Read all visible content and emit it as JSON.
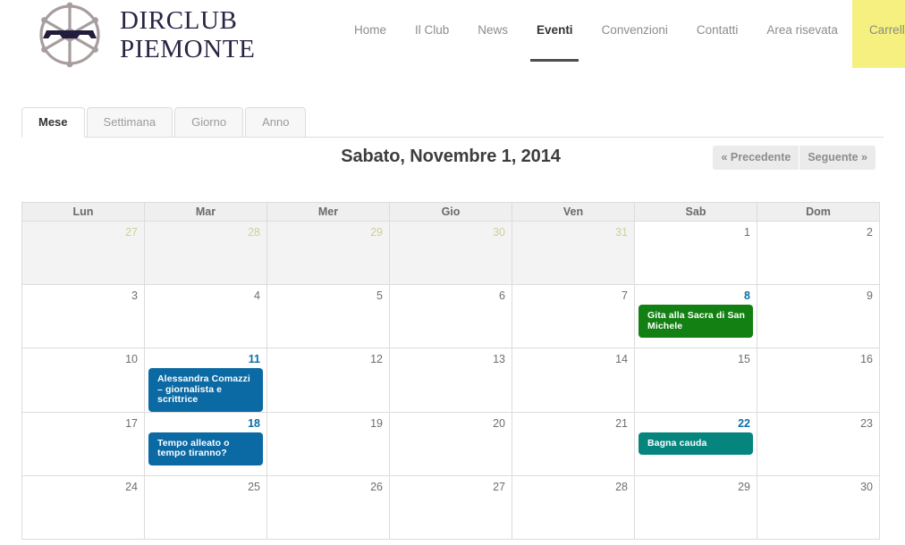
{
  "brand": {
    "logo_icon": "ship-wheel-logo",
    "line1": "DIRCLUB",
    "line2": "PIEMONTE"
  },
  "nav": {
    "items": [
      {
        "label": "Home",
        "active": false,
        "cart": false
      },
      {
        "label": "Il Club",
        "active": false,
        "cart": false
      },
      {
        "label": "News",
        "active": false,
        "cart": false
      },
      {
        "label": "Eventi",
        "active": true,
        "cart": false
      },
      {
        "label": "Convenzioni",
        "active": false,
        "cart": false
      },
      {
        "label": "Contatti",
        "active": false,
        "cart": false
      },
      {
        "label": "Area risevata",
        "active": false,
        "cart": false
      },
      {
        "label": "Carrello",
        "active": false,
        "cart": true
      }
    ],
    "cart_bg": "#f5f07f",
    "active_underline": "#4d4d4d"
  },
  "view_tabs": {
    "items": [
      {
        "label": "Mese",
        "active": true
      },
      {
        "label": "Settimana",
        "active": false
      },
      {
        "label": "Giorno",
        "active": false
      },
      {
        "label": "Anno",
        "active": false
      }
    ]
  },
  "calendar_header": {
    "title": "Sabato, Novembre 1, 2014",
    "prev_label": "« Precedente",
    "next_label": "Seguente »"
  },
  "calendar": {
    "weekdays": [
      "Lun",
      "Mar",
      "Mer",
      "Gio",
      "Ven",
      "Sab",
      "Dom"
    ],
    "today_border_color": "#80801a",
    "event_day_bg": "#fbfbe2",
    "link_color": "#0a6ea8",
    "weeks": [
      [
        {
          "day": "27",
          "other_month": true,
          "today": false,
          "events": []
        },
        {
          "day": "28",
          "other_month": true,
          "today": false,
          "events": []
        },
        {
          "day": "29",
          "other_month": true,
          "today": false,
          "events": []
        },
        {
          "day": "30",
          "other_month": true,
          "today": false,
          "events": []
        },
        {
          "day": "31",
          "other_month": true,
          "today": false,
          "events": []
        },
        {
          "day": "1",
          "other_month": false,
          "today": false,
          "events": []
        },
        {
          "day": "2",
          "other_month": false,
          "today": false,
          "events": []
        }
      ],
      [
        {
          "day": "3",
          "other_month": false,
          "today": false,
          "events": []
        },
        {
          "day": "4",
          "other_month": false,
          "today": false,
          "events": []
        },
        {
          "day": "5",
          "other_month": false,
          "today": false,
          "events": []
        },
        {
          "day": "6",
          "other_month": false,
          "today": false,
          "events": []
        },
        {
          "day": "7",
          "other_month": false,
          "today": false,
          "events": []
        },
        {
          "day": "8",
          "other_month": false,
          "today": false,
          "events": [
            {
              "title": "Gita alla Sacra di San Michele",
              "color": "green",
              "hex": "#138013"
            }
          ]
        },
        {
          "day": "9",
          "other_month": false,
          "today": false,
          "events": []
        }
      ],
      [
        {
          "day": "10",
          "other_month": false,
          "today": false,
          "events": []
        },
        {
          "day": "11",
          "other_month": false,
          "today": false,
          "events": [
            {
              "title": "Alessandra Comazzi – giornalista e scrittrice",
              "color": "blue",
              "hex": "#0b69a3"
            }
          ]
        },
        {
          "day": "12",
          "other_month": false,
          "today": false,
          "events": []
        },
        {
          "day": "13",
          "other_month": false,
          "today": false,
          "events": []
        },
        {
          "day": "14",
          "other_month": false,
          "today": false,
          "events": []
        },
        {
          "day": "15",
          "other_month": false,
          "today": false,
          "events": []
        },
        {
          "day": "16",
          "other_month": false,
          "today": true,
          "events": []
        }
      ],
      [
        {
          "day": "17",
          "other_month": false,
          "today": false,
          "events": []
        },
        {
          "day": "18",
          "other_month": false,
          "today": false,
          "events": [
            {
              "title": "Tempo alleato o tempo tiranno?",
              "color": "blue",
              "hex": "#0b69a3"
            }
          ]
        },
        {
          "day": "19",
          "other_month": false,
          "today": false,
          "events": []
        },
        {
          "day": "20",
          "other_month": false,
          "today": false,
          "events": []
        },
        {
          "day": "21",
          "other_month": false,
          "today": false,
          "events": []
        },
        {
          "day": "22",
          "other_month": false,
          "today": false,
          "events": [
            {
              "title": "Bagna cauda",
              "color": "teal",
              "hex": "#06857f"
            }
          ]
        },
        {
          "day": "23",
          "other_month": false,
          "today": false,
          "events": []
        }
      ],
      [
        {
          "day": "24",
          "other_month": false,
          "today": false,
          "events": []
        },
        {
          "day": "25",
          "other_month": false,
          "today": false,
          "events": []
        },
        {
          "day": "26",
          "other_month": false,
          "today": false,
          "events": []
        },
        {
          "day": "27",
          "other_month": false,
          "today": false,
          "events": []
        },
        {
          "day": "28",
          "other_month": false,
          "today": false,
          "events": []
        },
        {
          "day": "29",
          "other_month": false,
          "today": false,
          "events": []
        },
        {
          "day": "30",
          "other_month": false,
          "today": false,
          "events": []
        }
      ]
    ]
  }
}
